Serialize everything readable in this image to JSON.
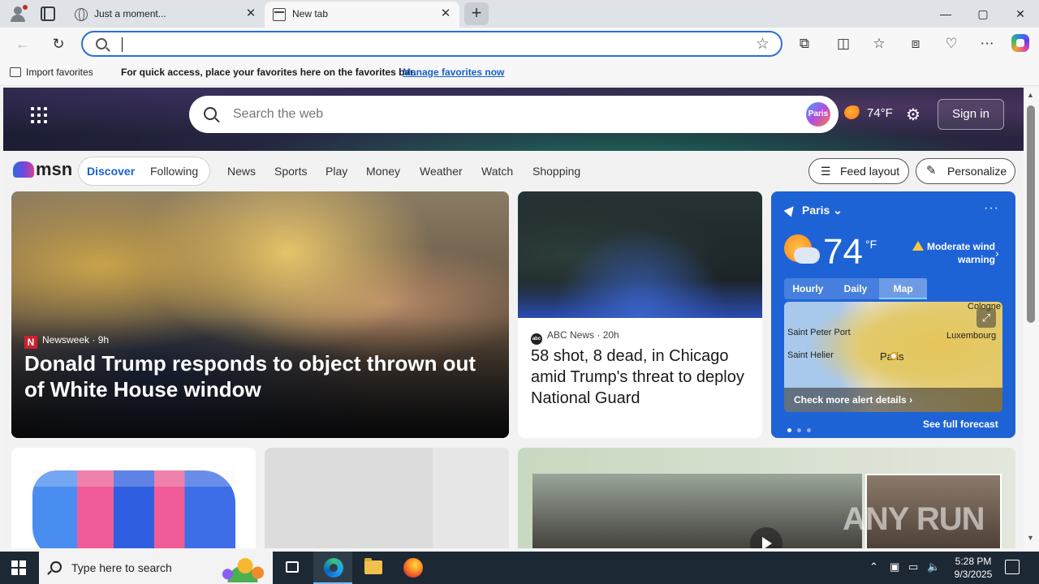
{
  "browser": {
    "tabs": [
      {
        "title": "Just a moment...",
        "icon": "globe-icon"
      },
      {
        "title": "New tab",
        "icon": "new-tab-icon"
      }
    ],
    "window_controls": {
      "minimize": "—",
      "maximize": "▢",
      "close": "✕"
    },
    "new_tab_symbol": "+",
    "close_tab_symbol": "✕",
    "address": {
      "value": "",
      "placeholder": ""
    }
  },
  "favorites_bar": {
    "import_label": "Import favorites",
    "message": "For quick access, place your favorites here on the favorites bar.",
    "manage_link": "Manage favorites now"
  },
  "msn": {
    "search_placeholder": "Search the web",
    "paris_badge": "Paris",
    "hero_temp": "74°F",
    "signin_label": "Sign in",
    "nav": {
      "discover": "Discover",
      "following": "Following",
      "items": [
        "News",
        "Sports",
        "Play",
        "Money",
        "Weather",
        "Watch",
        "Shopping"
      ]
    },
    "feed_layout_label": "Feed layout",
    "personalize_label": "Personalize"
  },
  "main_story": {
    "source": "Newsweek",
    "age": "9h",
    "headline": "Donald Trump responds to object thrown out of White House window"
  },
  "news_story": {
    "source": "ABC News",
    "age": "20h",
    "headline": "58 shot, 8 dead, in Chicago amid Trump's threat to deploy National Guard"
  },
  "weather": {
    "location": "Paris",
    "temp": "74",
    "unit": "°F",
    "alert": "Moderate wind warning",
    "tabs": [
      "Hourly",
      "Daily",
      "Map"
    ],
    "active_tab": "Map",
    "map_labels": {
      "saint_peter_port": "Saint Peter Port",
      "saint_helier": "Saint Helier",
      "paris": "Paris",
      "cologne": "Cologne",
      "luxembourg": "Luxembourg"
    },
    "alert_details": "Check more alert details",
    "see_forecast": "See full forecast"
  },
  "watermark": "ANY RUN",
  "taskbar": {
    "search_placeholder": "Type here to search",
    "time": "5:28 PM",
    "date": "9/3/2025"
  }
}
